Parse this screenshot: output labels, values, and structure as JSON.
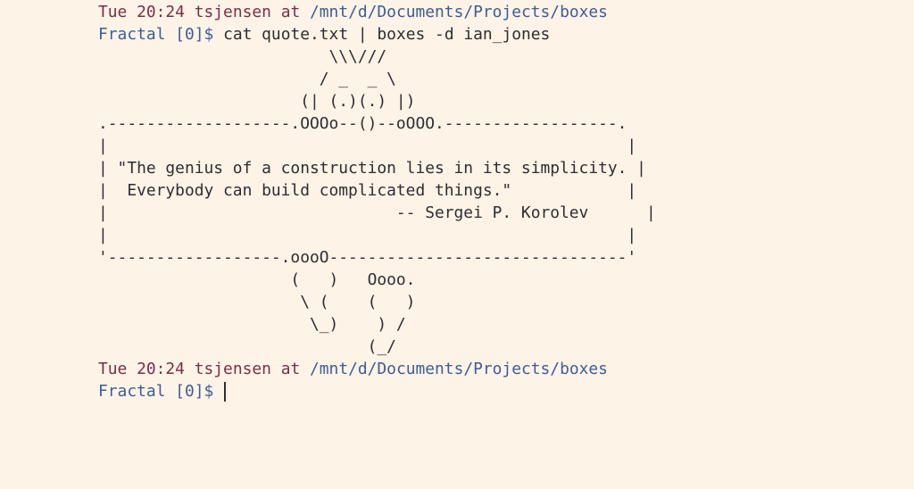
{
  "prompt1": {
    "datetime": "Tue 20:24",
    "user": "tsjensen",
    "at": "at",
    "path": "/mnt/d/Documents/Projects/boxes",
    "host": "Fractal",
    "job": "[0]",
    "dollar": "$",
    "command": "cat quote.txt | boxes -d ian_jones"
  },
  "output_lines": [
    "                        \\\\\\///",
    "                       / _  _ \\",
    "                     (| (.)(.) |)",
    ".-------------------.OOOo--()--oOOO.------------------.",
    "|                                                      |",
    "| \"The genius of a construction lies in its simplicity. |",
    "|  Everybody can build complicated things.\"            |",
    "|                              -- Sergei P. Korolev      |",
    "|                                                      |",
    "'------------------.oooO-------------------------------'",
    "                    (   )   Oooo.",
    "                     \\ (    (   )",
    "                      \\_)    ) /",
    "                            (_/"
  ],
  "prompt2": {
    "datetime": "Tue 20:24",
    "user": "tsjensen",
    "at": "at",
    "path": "/mnt/d/Documents/Projects/boxes",
    "host": "Fractal",
    "job": "[0]",
    "dollar": "$",
    "command": ""
  }
}
